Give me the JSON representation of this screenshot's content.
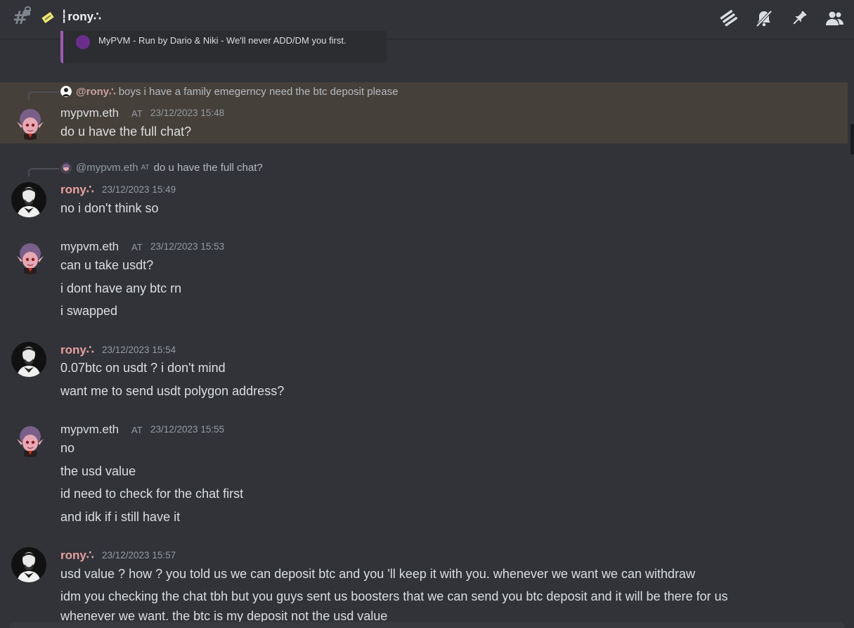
{
  "header": {
    "channel_name": "┆rony∴",
    "icons": [
      "threads-icon",
      "bell-off-icon",
      "pin-icon",
      "members-icon"
    ]
  },
  "embed_tail": {
    "text": "MyPVM - Run by Dario & Niki - We'll never ADD/DM you first."
  },
  "messages": [
    {
      "reply": {
        "name": "@rony∴",
        "text": "boys i have a family emegerncy need the btc deposit please"
      },
      "author": "mypvm.eth",
      "tag": "AT",
      "time": "23/12/2023 15:48",
      "lines": [
        "do u have the full chat?"
      ]
    },
    {
      "reply": {
        "name": "@mypvm.eth",
        "tag": "AT",
        "text": "do u have the full chat?"
      },
      "author": "rony∴",
      "time": "23/12/2023 15:49",
      "lines": [
        "no i don't think so"
      ]
    },
    {
      "author": "mypvm.eth",
      "tag": "AT",
      "time": "23/12/2023 15:53",
      "lines": [
        "can u take usdt?",
        "i dont have any btc rn",
        "i swapped"
      ]
    },
    {
      "author": "rony∴",
      "time": "23/12/2023 15:54",
      "lines": [
        "0.07btc on usdt ? i don't mind",
        "want me to send usdt polygon address?"
      ]
    },
    {
      "author": "mypvm.eth",
      "tag": "AT",
      "time": "23/12/2023 15:55",
      "lines": [
        "no",
        "the usd value",
        "id need to check for the chat first",
        "and idk if i still have it"
      ]
    },
    {
      "author": "rony∴",
      "time": "23/12/2023 15:57",
      "lines": [
        "usd value ? how ? you told us we can deposit btc and you 'll keep it with you. whenever we want we can withdraw",
        "idm you checking the chat tbh but you guys sent us boosters that we can send you btc deposit and it will be there for us",
        "whenever we want. the btc is my deposit not the usd value"
      ]
    }
  ],
  "colors": {
    "background": "#313338",
    "highlight": "#46403a",
    "embed_bar": "#9b59b6",
    "rony_name": "#e8a0a0"
  }
}
